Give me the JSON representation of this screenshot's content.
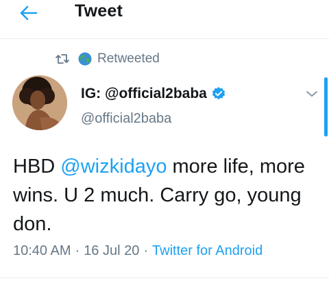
{
  "header": {
    "title": "Tweet",
    "back_icon": "arrow-left-icon"
  },
  "colors": {
    "accent": "#1da1f2",
    "secondary_text": "#657786",
    "primary_text": "#14171a"
  },
  "context": {
    "retweet_icon": "retweet-icon",
    "globe_icon": "globe-icon",
    "label": "Retweeted"
  },
  "tweet": {
    "author_name": "IG: @official2baba",
    "verified_icon": "verified-badge-icon",
    "handle": "@official2baba",
    "more_icon": "chevron-down-icon",
    "text_before": "HBD ",
    "mention": "@wizkidayo",
    "text_after": " more life, more wins. U 2 much. Carry go, young don.",
    "time": "10:40 AM",
    "date": "16 Jul 20",
    "separator": "·",
    "source": "Twitter for Android"
  }
}
